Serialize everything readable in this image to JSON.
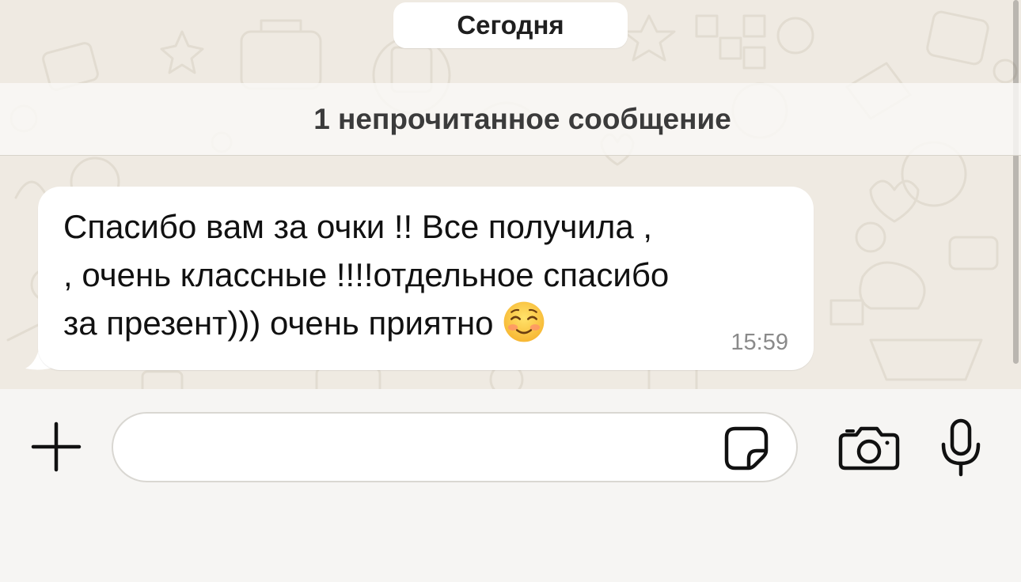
{
  "chat": {
    "date_label": "Сегодня",
    "unread_banner": "1 непрочитанное сообщение",
    "messages": [
      {
        "lines": [
          "Спасибо вам за очки !! Все получила ,",
          ", очень классные !!!!отдельное спасибо",
          "за презент))) очень приятно"
        ],
        "emoji": "smiling-face-with-blush-icon",
        "time": "15:59",
        "direction": "incoming"
      }
    ]
  },
  "composer": {
    "value": "",
    "placeholder": "",
    "icons": {
      "attach": "plus-icon",
      "sticker": "sticker-icon",
      "camera": "camera-icon",
      "voice": "microphone-icon"
    }
  },
  "colors": {
    "chat_background": "#efeae2",
    "bubble_incoming": "#ffffff",
    "composer_background": "#f6f5f3",
    "text_primary": "#111111",
    "timestamp": "#8a8a8a"
  }
}
